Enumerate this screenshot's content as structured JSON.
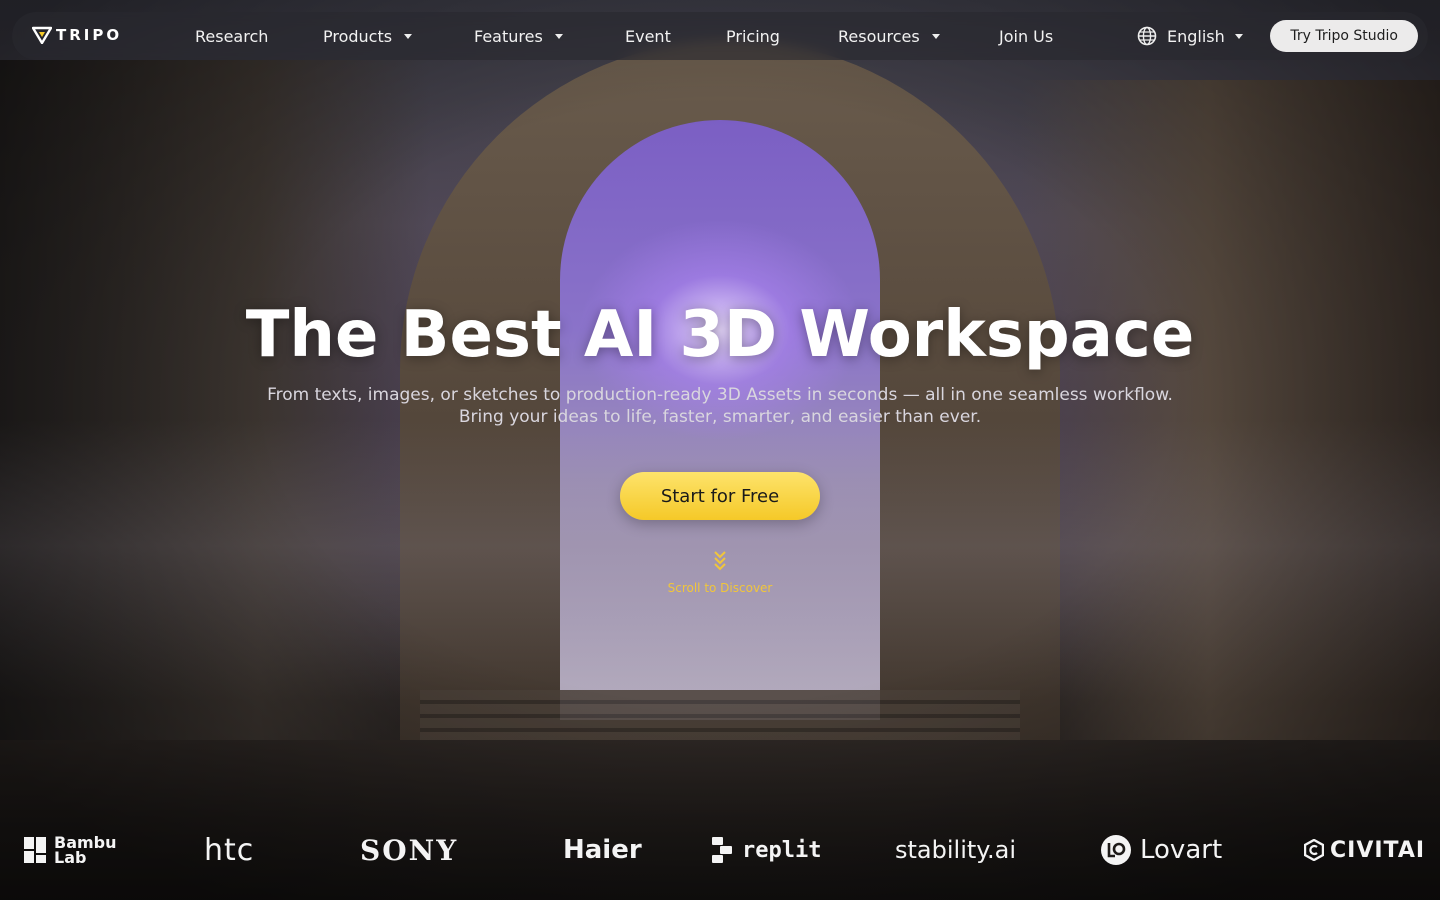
{
  "navbar": {
    "logo_text": "TRIPO",
    "items": [
      {
        "label": "Research"
      },
      {
        "label": "Products"
      },
      {
        "label": "Features"
      },
      {
        "label": "Event"
      },
      {
        "label": "Pricing"
      },
      {
        "label": "Resources"
      },
      {
        "label": "Join Us"
      }
    ],
    "language": "English",
    "try_button": "Try Tripo Studio"
  },
  "hero": {
    "title": "The Best AI 3D Workspace",
    "subtitle_line1": "From texts, images, or sketches to production-ready 3D Assets in seconds — all in one seamless workflow.",
    "subtitle_line2": "Bring your ideas to life, faster, smarter, and easier than ever.",
    "cta": "Start for Free",
    "scroll_hint": "Scroll to Discover"
  },
  "partners": {
    "bambu_line1": "Bambu",
    "bambu_line2": "Lab",
    "htc": "htc",
    "sony": "SONY",
    "haier": "Haier",
    "replit": "replit",
    "stability": "stability.ai",
    "lovart": "Lovart",
    "civitai": "CIVITAI"
  },
  "colors": {
    "accent_yellow": "#f5c928",
    "scroll_text": "#f1c63a",
    "nav_bg": "#28282e"
  }
}
